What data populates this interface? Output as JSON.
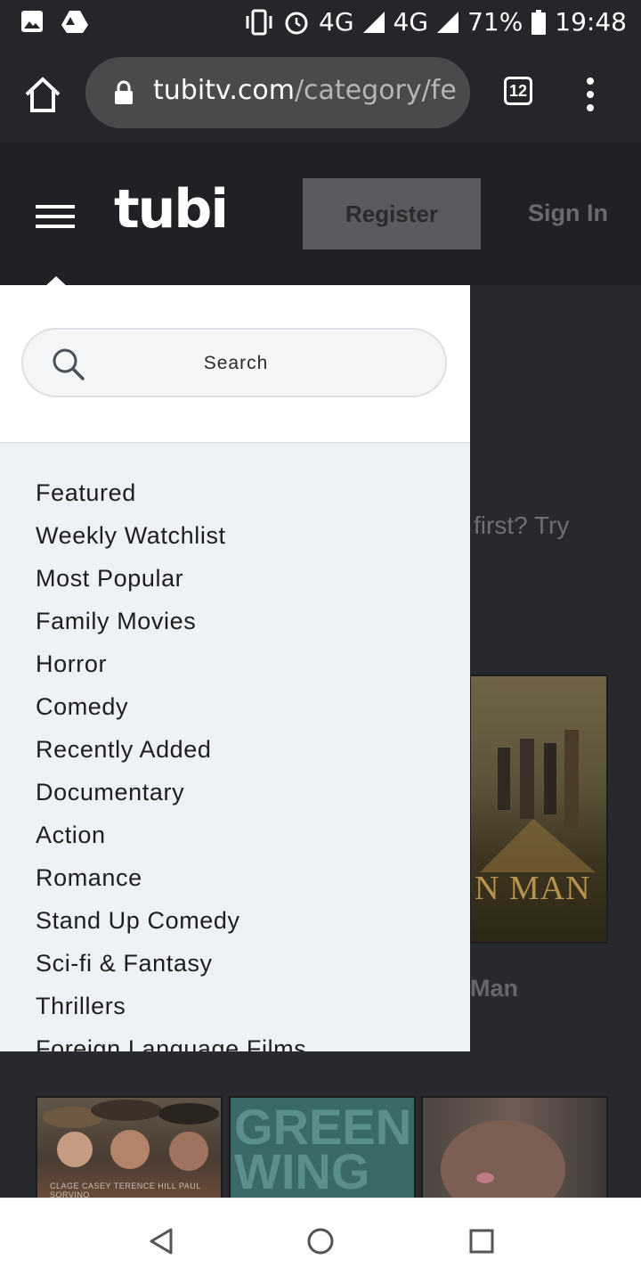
{
  "status_bar": {
    "icons": [
      "image-icon",
      "drive-icon",
      "vibrate-icon",
      "alarm-icon",
      "signal-icon",
      "battery-icon"
    ],
    "network1": "4G",
    "network2": "4G",
    "network2_super": "4G",
    "battery": "71%",
    "time": "19:48"
  },
  "browser": {
    "url_host": "tubitv.com",
    "url_path": "/category/fea",
    "tab_count": "12"
  },
  "site": {
    "logo": "tubi",
    "register_label": "Register",
    "signin_label": "Sign In",
    "bg_text_1": "first? Try",
    "bg_poster_title": "N MAN",
    "bg_text_2": "Man",
    "thumb2_title_line1": "GREEN",
    "thumb2_title_line2": "WING",
    "thumb1_credits": "CLAGE CASEY    TERENCE HILL    PAUL SORVINO"
  },
  "dropdown": {
    "search_placeholder": "Search",
    "categories": [
      "Featured",
      "Weekly Watchlist",
      "Most Popular",
      "Family Movies",
      "Horror",
      "Comedy",
      "Recently Added",
      "Documentary",
      "Action",
      "Romance",
      "Stand Up Comedy",
      "Sci-fi & Fantasy",
      "Thrillers",
      "Foreign Language Films"
    ]
  },
  "colors": {
    "status_bg": "#252629",
    "site_bg": "#28292e",
    "dropdown_bg": "#eef1f5",
    "register_bg": "#5b5b5f"
  }
}
